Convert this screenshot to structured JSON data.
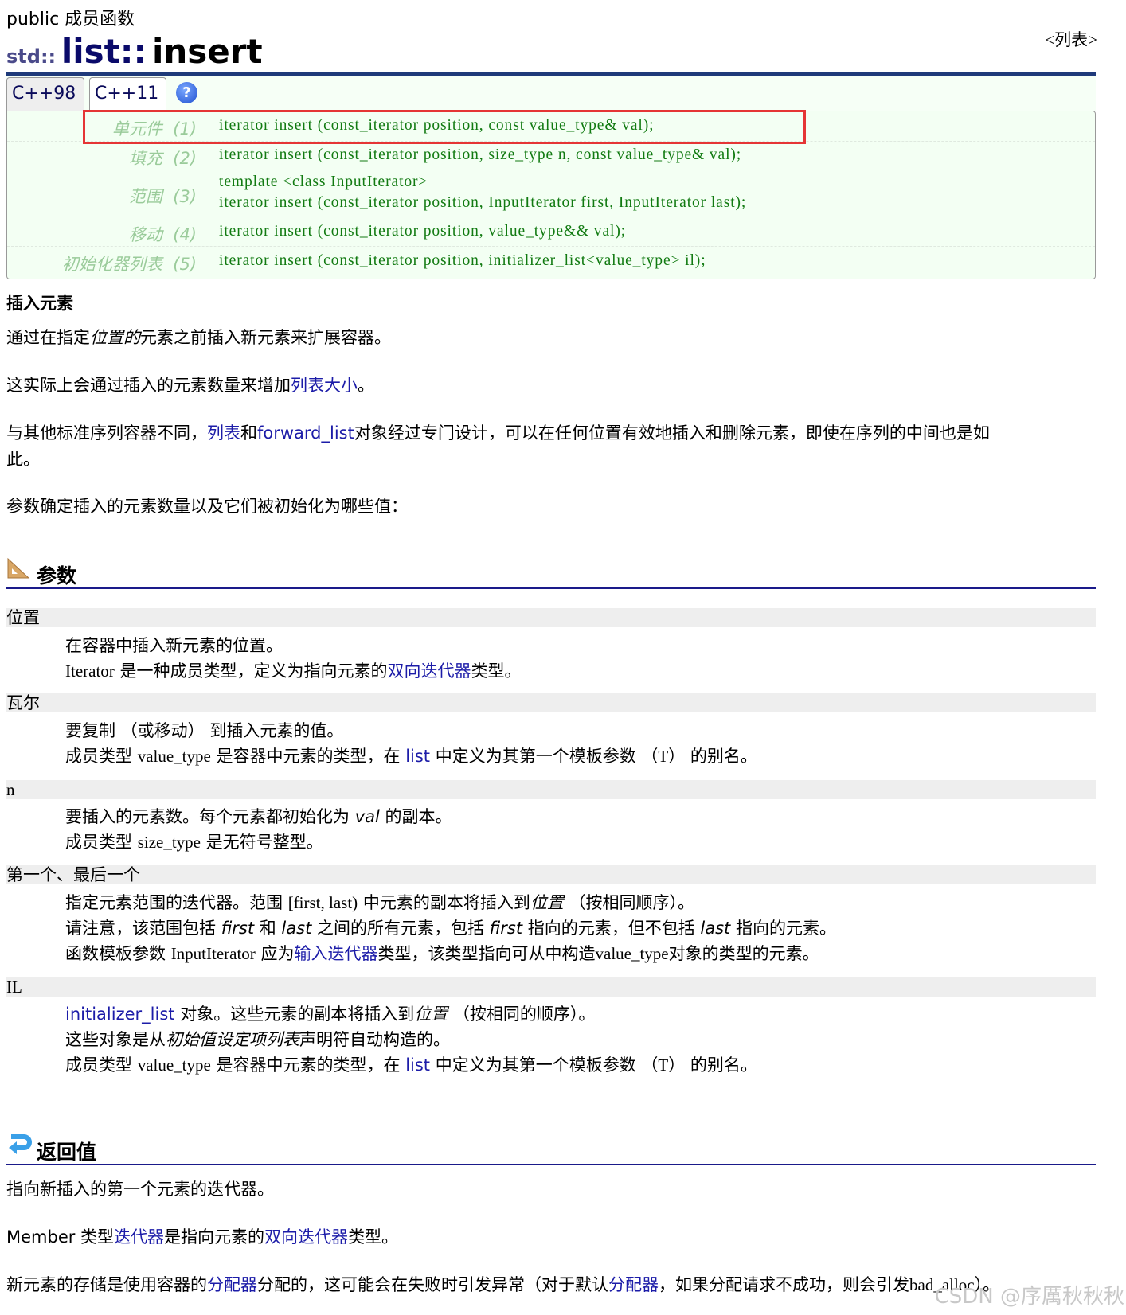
{
  "header": {
    "kind": "public 成员函数",
    "ns": "std::",
    "cls": "list::",
    "func": "insert",
    "container_link": "<列表>"
  },
  "tabs": [
    {
      "label": "C++98"
    },
    {
      "label": "C++11"
    }
  ],
  "help_icon": "?",
  "signatures": [
    {
      "label": "单元件",
      "num": "(1)",
      "code": [
        "iterator insert (const_iterator position, const value_type& val);"
      ]
    },
    {
      "label": "填充",
      "num": "(2)",
      "code": [
        "iterator insert (const_iterator position, size_type n, const value_type& val);"
      ]
    },
    {
      "label": "范围",
      "num": "(3)",
      "code": [
        "template <class InputIterator>",
        "iterator insert (const_iterator position, InputIterator first, InputIterator last);"
      ]
    },
    {
      "label": "移动",
      "num": "(4)",
      "code": [
        "iterator insert (const_iterator position, value_type&& val);"
      ]
    },
    {
      "label": "初始化器列表",
      "num": "(5)",
      "code": [
        "iterator insert (const_iterator position, initializer_list<value_type> il);"
      ]
    }
  ],
  "summary": {
    "heading": "插入元素",
    "p1": [
      "通过在指定",
      "位置的",
      "元素之前插入新元素来扩展容器。"
    ],
    "p2": [
      "这实际上会通过插入的元素数量来增加",
      "列表大小",
      "。"
    ],
    "p3": [
      "与其他标准序列容器不同，",
      "列表",
      "和",
      "forward_list",
      "对象经过专门设计，可以在任何位置有效地插入和删除元素，即使在序列的中间也是如",
      "此。"
    ],
    "p4": "参数确定插入的元素数量以及它们被初始化为哪些值："
  },
  "params": {
    "heading": "参数",
    "position": {
      "name": "位置",
      "l1": "在容器中插入新元素的位置。",
      "l2": [
        "Iterator",
        " 是一种成员类型，定义为指向元素的",
        "双向迭代器",
        "类型。"
      ]
    },
    "val": {
      "name": "瓦尔",
      "l1": "要复制 （或移动） 到插入元素的值。",
      "l2": [
        "成员类型 ",
        "value_type",
        " 是容器中元素的类型，在 ",
        "list",
        " 中定义为其第一个模板参数 （",
        "T",
        "） 的别名。"
      ]
    },
    "n": {
      "name": "n",
      "l1": [
        "要插入的元素数。每个元素都初始化为 ",
        "val",
        " 的副本。"
      ],
      "l2": [
        "成员类型 ",
        "size_type",
        " 是无符号整型。"
      ]
    },
    "range": {
      "name": "第一个、最后一个",
      "l1": [
        "指定元素范围的迭代器。范围 ",
        "[first, last)",
        " 中元素的副本将插入到",
        "位置",
        " （按相同顺序）。"
      ],
      "l2": [
        "请注意，该范围包括 ",
        "first",
        " 和 ",
        "last",
        " 之间的所有元素，包括 ",
        "first",
        " 指向的元素，但不包括 ",
        "last",
        " 指向的元素。"
      ],
      "l3": [
        "函数模板参数 ",
        "InputIterator",
        " 应为",
        "输入迭代器",
        "类型，该类型指向可从中构造",
        "value_type",
        "对象的类型的元素。"
      ]
    },
    "il": {
      "name": "IL",
      "l1": [
        "initializer_list",
        " 对象。这些元素的副本将插入到",
        "位置",
        " （按相同的顺序）。"
      ],
      "l2": [
        "这些对象是从",
        "初始值设定项列表",
        "声明符自动构造的。"
      ],
      "l3": [
        "成员类型 ",
        "value_type",
        " 是容器中元素的类型，在 ",
        "list",
        " 中定义为其第一个模板参数 （",
        "T",
        "） 的别名。"
      ]
    }
  },
  "return": {
    "heading": "返回值",
    "p1": "指向新插入的第一个元素的迭代器。",
    "p2": [
      "Member 类型",
      "迭代器",
      "是指向元素的",
      "双向迭代器",
      "类型。"
    ],
    "p3": [
      "新元素的存储是使用容器的",
      "分配器",
      "分配的，这可能会在失败时引发异常（对于默认",
      "分配器",
      "，如果分配请求不成功，则会引发",
      "bad_alloc",
      "）。"
    ]
  },
  "watermark": "CSDN @序厲秋秋秋"
}
